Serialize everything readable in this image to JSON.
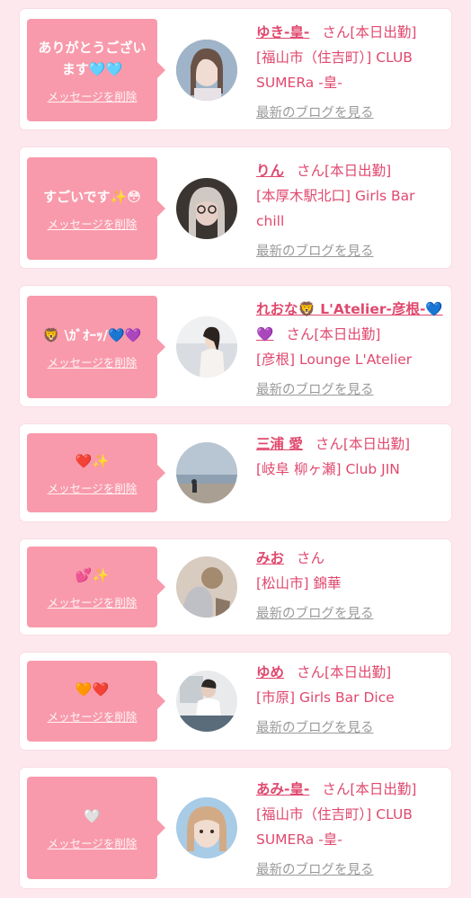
{
  "messages": [
    {
      "text": "ありがとうございます🩵🩵",
      "delete_label": "メッセージを削除",
      "name": "ゆき-皇-",
      "suffix": "さん[本日出勤]",
      "shop": "[福山市（住吉町）] CLUB SUMERa -皇-",
      "blog_label": "最新のブログを見る"
    },
    {
      "text": "すごいです✨😳",
      "delete_label": "メッセージを削除",
      "name": "りん",
      "suffix": "さん[本日出勤]",
      "shop": "[本厚木駅北口] Girls Bar chill",
      "blog_label": "最新のブログを見る"
    },
    {
      "text": "🦁 \\ｶﾞｵｰｯ/💙💜",
      "delete_label": "メッセージを削除",
      "name": "れおな🦁 L'Atelier-彦根-💙💜",
      "suffix": "さん[本日出勤]",
      "shop": "[彦根] Lounge L'Atelier",
      "blog_label": "最新のブログを見る"
    },
    {
      "text": "❤️✨",
      "delete_label": "メッセージを削除",
      "name": "三浦 愛",
      "suffix": "さん[本日出勤]",
      "shop": "[岐阜 柳ヶ瀬] Club JIN",
      "blog_label": ""
    },
    {
      "text": "💕✨",
      "delete_label": "メッセージを削除",
      "name": "みお",
      "suffix": "さん",
      "shop": "[松山市] 錦華",
      "blog_label": "最新のブログを見る"
    },
    {
      "text": "🧡❤️",
      "delete_label": "メッセージを削除",
      "name": "ゆめ",
      "suffix": "さん[本日出勤]",
      "shop": "[市原] Girls Bar Dice",
      "blog_label": "最新のブログを見る"
    },
    {
      "text": "🤍",
      "delete_label": "メッセージを削除",
      "name": "あみ-皇-",
      "suffix": "さん[本日出勤]",
      "shop": "[福山市（住吉町）] CLUB SUMERa -皇-",
      "blog_label": "最新のブログを見る"
    }
  ],
  "colors": {
    "background": "#fde8ee",
    "bubble": "#f89aab",
    "name_text": "#e0486e",
    "blog_link": "#9a9a9a"
  }
}
